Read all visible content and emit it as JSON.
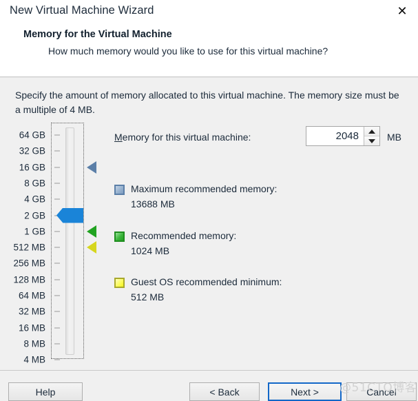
{
  "window": {
    "title": "New Virtual Machine Wizard",
    "close_icon": "close-icon"
  },
  "header": {
    "title": "Memory for the Virtual Machine",
    "subtitle": "How much memory would you like to use for this virtual machine?"
  },
  "body": {
    "intro": "Specify the amount of memory allocated to this virtual machine. The memory size must be a multiple of 4 MB."
  },
  "memory_field": {
    "label_prefix": "M",
    "label_rest": "emory for this virtual machine:",
    "value": "2048",
    "unit": "MB",
    "spin_up_icon": "arrow-up-icon",
    "spin_down_icon": "arrow-down-icon"
  },
  "slider": {
    "scale_labels": [
      "64 GB",
      "32 GB",
      "16 GB",
      "8 GB",
      "4 GB",
      "2 GB",
      "1 GB",
      "512 MB",
      "256 MB",
      "128 MB",
      "64 MB",
      "32 MB",
      "16 MB",
      "8 MB",
      "4 MB"
    ],
    "current_label": "2 GB",
    "thumb_index": 5,
    "markers": [
      {
        "name": "maximum-recommended-marker",
        "color": "#5b7fa8",
        "index": 2
      },
      {
        "name": "recommended-marker",
        "color": "#21a321",
        "index": 6
      },
      {
        "name": "guest-os-minimum-marker",
        "color": "#d6d61e",
        "index": 7
      }
    ]
  },
  "legend": [
    {
      "title": "Maximum recommended memory:",
      "value": "13688 MB",
      "color": "#7e9cc0",
      "swatch": "blue"
    },
    {
      "title": "Recommended memory:",
      "value": "1024 MB",
      "color": "#23a023",
      "swatch": "green"
    },
    {
      "title": "Guest OS recommended minimum:",
      "value": "512 MB",
      "color": "#f2f21f",
      "swatch": "yellow"
    }
  ],
  "footer": {
    "help": "Help",
    "back": "< Back",
    "next": "Next >",
    "cancel": "Cancel"
  },
  "watermark": "@51CTO博客"
}
